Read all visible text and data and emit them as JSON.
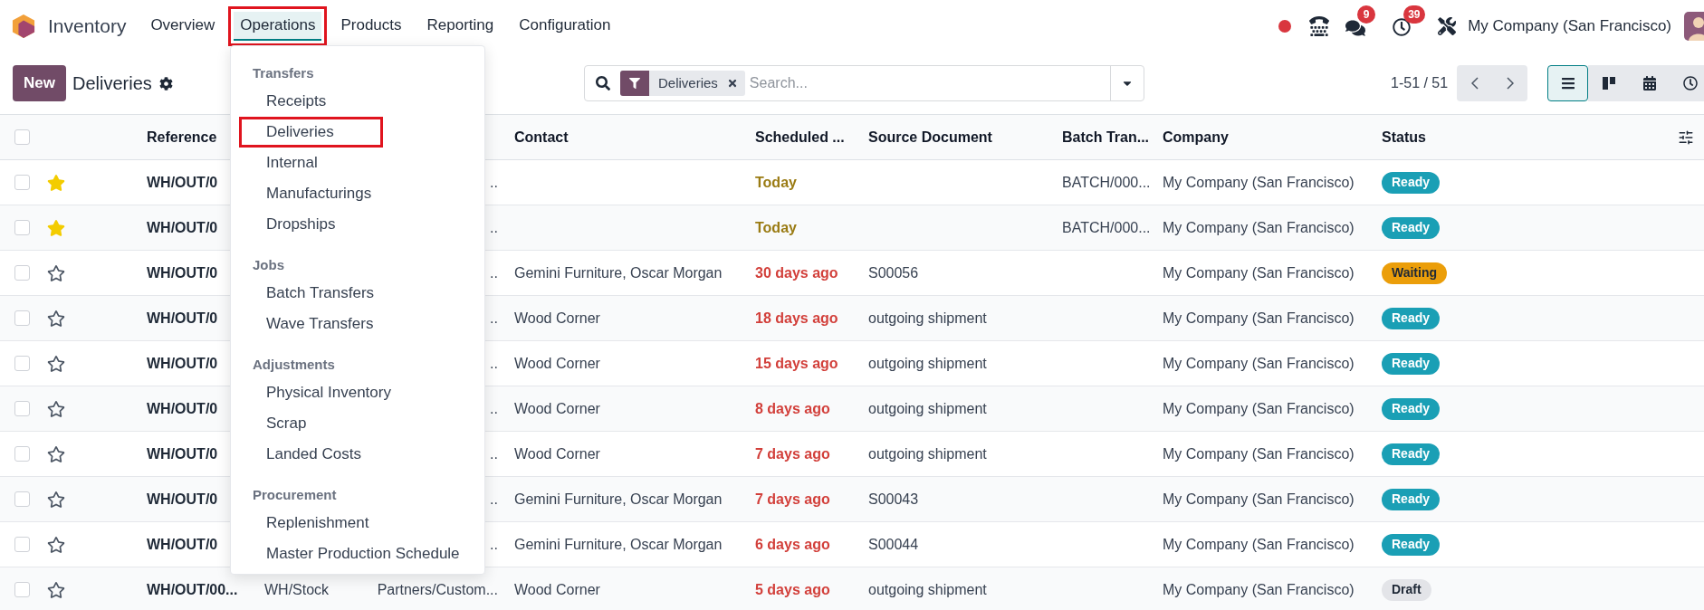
{
  "app": {
    "name": "Inventory"
  },
  "menu": {
    "items": [
      {
        "label": "Overview",
        "selected": false,
        "highlighted": false
      },
      {
        "label": "Operations",
        "selected": true,
        "highlighted": true
      },
      {
        "label": "Products",
        "selected": false,
        "highlighted": false
      },
      {
        "label": "Reporting",
        "selected": false,
        "highlighted": false
      },
      {
        "label": "Configuration",
        "selected": false,
        "highlighted": false
      }
    ]
  },
  "systray": {
    "chat_badge": "9",
    "activity_badge": "39",
    "company": "My Company (San Francisco)"
  },
  "control_panel": {
    "new_button": "New",
    "title": "Deliveries",
    "search": {
      "facet": "Deliveries",
      "placeholder": "Search..."
    },
    "pager": "1-51 / 51",
    "views": [
      {
        "kind": "list",
        "selected": true
      },
      {
        "kind": "kanban",
        "selected": false
      },
      {
        "kind": "calendar",
        "selected": false
      },
      {
        "kind": "activity",
        "selected": false
      }
    ]
  },
  "dropdown": {
    "sections": [
      {
        "title": "Transfers",
        "items": [
          {
            "label": "Receipts",
            "highlighted": false
          },
          {
            "label": "Deliveries",
            "highlighted": true
          },
          {
            "label": "Internal",
            "highlighted": false
          },
          {
            "label": "Manufacturings",
            "highlighted": false
          },
          {
            "label": "Dropships",
            "highlighted": false
          }
        ]
      },
      {
        "title": "Jobs",
        "items": [
          {
            "label": "Batch Transfers",
            "highlighted": false
          },
          {
            "label": "Wave Transfers",
            "highlighted": false
          }
        ]
      },
      {
        "title": "Adjustments",
        "items": [
          {
            "label": "Physical Inventory",
            "highlighted": false
          },
          {
            "label": "Scrap",
            "highlighted": false
          },
          {
            "label": "Landed Costs",
            "highlighted": false
          }
        ]
      },
      {
        "title": "Procurement",
        "items": [
          {
            "label": "Replenishment",
            "highlighted": false
          },
          {
            "label": "Master Production Schedule",
            "highlighted": false
          }
        ]
      }
    ]
  },
  "table": {
    "header_checked": false,
    "columns": [
      "Reference",
      "Contact",
      "Scheduled ...",
      "Source Document",
      "Batch Tran...",
      "Company",
      "Status"
    ],
    "rows": [
      {
        "checked": false,
        "starred": true,
        "reference": "WH/OUT/0",
        "column_4": "..",
        "scheduled": {
          "text": "Today",
          "kind": "today"
        },
        "batch": "BATCH/000...",
        "company": "My Company (San Francisco)",
        "status": {
          "label": "Ready",
          "kind": "ready"
        }
      },
      {
        "checked": false,
        "starred": true,
        "reference": "WH/OUT/0",
        "column_4": "..",
        "scheduled": {
          "text": "Today",
          "kind": "today"
        },
        "batch": "BATCH/000...",
        "company": "My Company (San Francisco)",
        "status": {
          "label": "Ready",
          "kind": "ready"
        }
      },
      {
        "checked": false,
        "starred": false,
        "reference": "WH/OUT/0",
        "column_4": "..",
        "contact": "Gemini Furniture, Oscar Morgan",
        "scheduled": {
          "text": "30 days ago",
          "kind": "late"
        },
        "source": "S00056",
        "company": "My Company (San Francisco)",
        "status": {
          "label": "Waiting",
          "kind": "waiting"
        }
      },
      {
        "checked": false,
        "starred": false,
        "reference": "WH/OUT/0",
        "column_4": "..",
        "contact": "Wood Corner",
        "scheduled": {
          "text": "18 days ago",
          "kind": "late"
        },
        "source": "outgoing shipment",
        "company": "My Company (San Francisco)",
        "status": {
          "label": "Ready",
          "kind": "ready"
        }
      },
      {
        "checked": false,
        "starred": false,
        "reference": "WH/OUT/0",
        "column_4": "..",
        "contact": "Wood Corner",
        "scheduled": {
          "text": "15 days ago",
          "kind": "late"
        },
        "source": "outgoing shipment",
        "company": "My Company (San Francisco)",
        "status": {
          "label": "Ready",
          "kind": "ready"
        }
      },
      {
        "checked": false,
        "starred": false,
        "reference": "WH/OUT/0",
        "column_4": "..",
        "contact": "Wood Corner",
        "scheduled": {
          "text": "8 days ago",
          "kind": "late"
        },
        "source": "outgoing shipment",
        "company": "My Company (San Francisco)",
        "status": {
          "label": "Ready",
          "kind": "ready"
        }
      },
      {
        "checked": false,
        "starred": false,
        "reference": "WH/OUT/0",
        "column_4": "..",
        "contact": "Wood Corner",
        "scheduled": {
          "text": "7 days ago",
          "kind": "late"
        },
        "source": "outgoing shipment",
        "company": "My Company (San Francisco)",
        "status": {
          "label": "Ready",
          "kind": "ready"
        }
      },
      {
        "checked": false,
        "starred": false,
        "reference": "WH/OUT/0",
        "column_4": "..",
        "contact": "Gemini Furniture, Oscar Morgan",
        "scheduled": {
          "text": "7 days ago",
          "kind": "late"
        },
        "source": "S00043",
        "company": "My Company (San Francisco)",
        "status": {
          "label": "Ready",
          "kind": "ready"
        }
      },
      {
        "checked": false,
        "starred": false,
        "reference": "WH/OUT/0",
        "column_4": "..",
        "contact": "Gemini Furniture, Oscar Morgan",
        "scheduled": {
          "text": "6 days ago",
          "kind": "late"
        },
        "source": "S00044",
        "company": "My Company (San Francisco)",
        "status": {
          "label": "Ready",
          "kind": "ready"
        }
      },
      {
        "checked": false,
        "starred": false,
        "reference": "WH/OUT/00...",
        "column_3": "WH/Stock",
        "column_4": "Partners/Custom...",
        "contact": "Wood Corner",
        "scheduled": {
          "text": "5 days ago",
          "kind": "late"
        },
        "source": "outgoing shipment",
        "company": "My Company (San Francisco)",
        "status": {
          "label": "Draft",
          "kind": "draft"
        }
      }
    ]
  }
}
